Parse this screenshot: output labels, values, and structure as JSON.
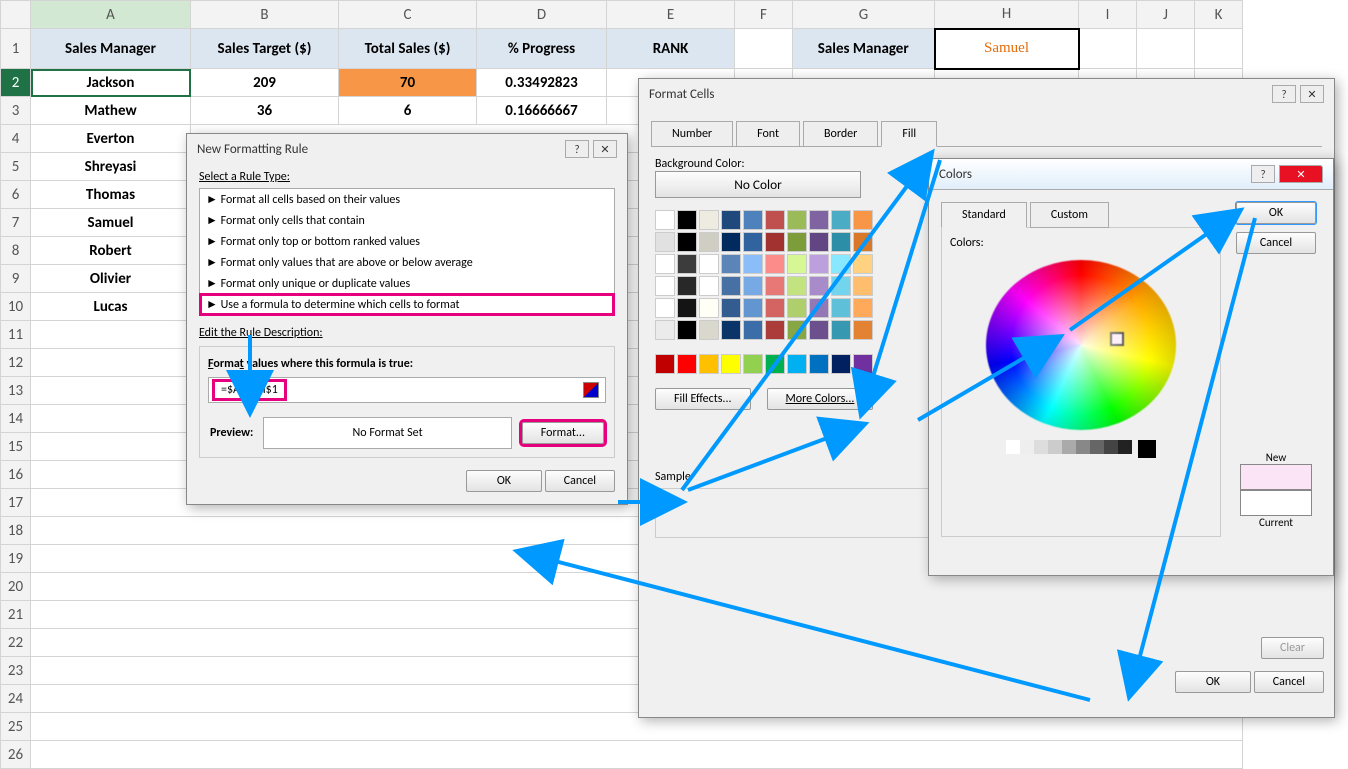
{
  "sheet": {
    "col_headers": [
      "A",
      "B",
      "C",
      "D",
      "E",
      "F",
      "G",
      "H",
      "I",
      "J",
      "K"
    ],
    "headers": {
      "A": "Sales Manager",
      "B": "Sales Target ($)",
      "C": "Total Sales ($)",
      "D": "% Progress",
      "E": "RANK",
      "G": "Sales Manager",
      "H": "Samuel"
    },
    "rows": [
      {
        "n": "2",
        "A": "Jackson",
        "B": "209",
        "C": "70",
        "D": "0.33492823"
      },
      {
        "n": "3",
        "A": "Mathew",
        "B": "36",
        "C": "6",
        "D": "0.16666667"
      },
      {
        "n": "4",
        "A": "Everton",
        "B": "",
        "C": "",
        "D": ""
      },
      {
        "n": "5",
        "A": "Shreyasi"
      },
      {
        "n": "6",
        "A": "Thomas"
      },
      {
        "n": "7",
        "A": "Samuel"
      },
      {
        "n": "8",
        "A": "Robert"
      },
      {
        "n": "9",
        "A": "Olivier"
      },
      {
        "n": "10",
        "A": "Lucas"
      }
    ]
  },
  "rule_dlg": {
    "title": "New Formatting Rule",
    "select_label": "Select a Rule Type:",
    "rules": [
      "Format all cells based on their values",
      "Format only cells that contain",
      "Format only top or bottom ranked values",
      "Format only values that are above or below average",
      "Format only unique or duplicate values",
      "Use a formula to determine which cells to format"
    ],
    "edit_label": "Edit the Rule Description:",
    "formula_label": "Format values where this formula is true:",
    "formula": "=$A2=$H$1",
    "preview_label": "Preview:",
    "preview_text": "No Format Set",
    "format_btn": "Format...",
    "ok": "OK",
    "cancel": "Cancel"
  },
  "format_dlg": {
    "title": "Format Cells",
    "tabs": [
      "Number",
      "Font",
      "Border",
      "Fill"
    ],
    "bg_label": "Background Color:",
    "no_color": "No Color",
    "fill_effects": "Fill Effects...",
    "more_colors": "More Colors...",
    "sample": "Sample",
    "clear": "Clear",
    "ok": "OK",
    "cancel": "Cancel"
  },
  "colors_dlg": {
    "title": "Colors",
    "tabs": [
      "Standard",
      "Custom"
    ],
    "colors_label": "Colors:",
    "new": "New",
    "current": "Current",
    "ok": "OK",
    "cancel": "Cancel"
  },
  "palette_row1": [
    "#ffffff",
    "#000000",
    "#eeece1",
    "#1f497d",
    "#4f81bd",
    "#c0504d",
    "#9bbb59",
    "#8064a2",
    "#4bacc6",
    "#f79646"
  ],
  "palette_std": [
    "#c00000",
    "#ff0000",
    "#ffc000",
    "#ffff00",
    "#92d050",
    "#00b050",
    "#00b0f0",
    "#0070c0",
    "#002060",
    "#7030a0"
  ]
}
